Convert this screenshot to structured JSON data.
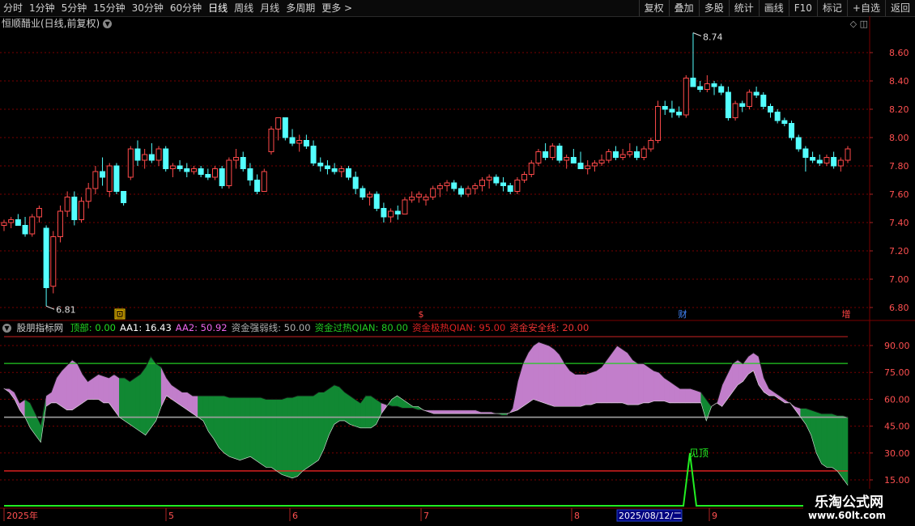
{
  "toolbar": {
    "left": [
      "分时",
      "1分钟",
      "5分钟",
      "15分钟",
      "30分钟",
      "60分钟",
      "日线",
      "周线",
      "月线",
      "多周期",
      "更多 >"
    ],
    "active": "日线",
    "right": [
      "复权",
      "叠加",
      "多股",
      "统计",
      "画线",
      "F10",
      "标记",
      "+自选",
      "返回"
    ]
  },
  "stock": {
    "title": "恒顺醋业(日线,前复权)"
  },
  "main_axis": [
    "8.60",
    "8.40",
    "8.20",
    "8.00",
    "7.80",
    "7.60",
    "7.40",
    "7.20",
    "7.00",
    "6.80"
  ],
  "annotations": {
    "high": "8.74",
    "low": "6.81"
  },
  "markers": [
    "回",
    "$",
    "财",
    "增"
  ],
  "indicator": {
    "name": "股朋指标网",
    "items": [
      {
        "label": "顶部: 0.00",
        "color": "#22dd22"
      },
      {
        "label": "AA1: 16.43",
        "color": "#ffffff"
      },
      {
        "label": "AA2: 50.92",
        "color": "#ee66ee"
      },
      {
        "label": "资金强弱线: 50.00",
        "color": "#b0b0b0"
      },
      {
        "label": "资金过热QIAN: 80.00",
        "color": "#22cc22"
      },
      {
        "label": "资金极热QIAN: 95.00",
        "color": "#dd2222"
      },
      {
        "label": "资金安全线: 20.00",
        "color": "#ee3333"
      }
    ],
    "axis": [
      "90.00",
      "75.00",
      "60.00",
      "45.00",
      "30.00",
      "15.00"
    ],
    "signal_label": "见顶"
  },
  "date_axis": {
    "labels": [
      "2025年",
      "5",
      "6",
      "7",
      "8",
      "9"
    ],
    "cursor": "2025/08/12/二"
  },
  "watermark": {
    "title": "乐淘公式网",
    "url": "www.60lt.com"
  },
  "chart_data": {
    "type": "candlestick",
    "title": "恒顺醋业(日线,前复权)",
    "y_ticks": [
      8.6,
      8.4,
      8.2,
      8.0,
      7.8,
      7.6,
      7.4,
      7.2,
      7.0,
      6.8
    ],
    "high": 8.74,
    "low": 6.81,
    "ohlc": [
      [
        7.38,
        7.42,
        7.34,
        7.4
      ],
      [
        7.4,
        7.44,
        7.36,
        7.42
      ],
      [
        7.42,
        7.46,
        7.38,
        7.38
      ],
      [
        7.38,
        7.44,
        7.3,
        7.32
      ],
      [
        7.32,
        7.46,
        7.3,
        7.44
      ],
      [
        7.44,
        7.52,
        7.4,
        7.5
      ],
      [
        7.36,
        7.38,
        6.81,
        6.94
      ],
      [
        6.95,
        7.34,
        6.9,
        7.3
      ],
      [
        7.3,
        7.52,
        7.26,
        7.48
      ],
      [
        7.48,
        7.62,
        7.44,
        7.58
      ],
      [
        7.58,
        7.62,
        7.38,
        7.42
      ],
      [
        7.42,
        7.58,
        7.4,
        7.55
      ],
      [
        7.55,
        7.68,
        7.5,
        7.64
      ],
      [
        7.64,
        7.8,
        7.6,
        7.76
      ],
      [
        7.76,
        7.86,
        7.66,
        7.72
      ],
      [
        7.62,
        7.82,
        7.58,
        7.8
      ],
      [
        7.8,
        7.82,
        7.6,
        7.62
      ],
      [
        7.62,
        7.6,
        7.52,
        7.54
      ],
      [
        7.72,
        7.94,
        7.7,
        7.92
      ],
      [
        7.92,
        7.98,
        7.8,
        7.84
      ],
      [
        7.84,
        7.92,
        7.78,
        7.88
      ],
      [
        7.88,
        7.96,
        7.82,
        7.84
      ],
      [
        7.84,
        7.94,
        7.8,
        7.92
      ],
      [
        7.92,
        7.94,
        7.76,
        7.78
      ],
      [
        7.78,
        7.82,
        7.72,
        7.8
      ],
      [
        7.8,
        7.84,
        7.76,
        7.78
      ],
      [
        7.78,
        7.82,
        7.72,
        7.76
      ],
      [
        7.76,
        7.8,
        7.74,
        7.78
      ],
      [
        7.78,
        7.8,
        7.72,
        7.74
      ],
      [
        7.74,
        7.78,
        7.7,
        7.72
      ],
      [
        7.72,
        7.8,
        7.7,
        7.78
      ],
      [
        7.78,
        7.8,
        7.64,
        7.66
      ],
      [
        7.66,
        7.86,
        7.64,
        7.84
      ],
      [
        7.84,
        7.92,
        7.78,
        7.86
      ],
      [
        7.86,
        7.9,
        7.76,
        7.78
      ],
      [
        7.78,
        7.82,
        7.66,
        7.7
      ],
      [
        7.7,
        7.74,
        7.6,
        7.62
      ],
      [
        7.62,
        7.78,
        7.62,
        7.76
      ],
      [
        7.9,
        8.08,
        7.88,
        8.06
      ],
      [
        8.06,
        8.12,
        7.98,
        8.14
      ],
      [
        8.14,
        8.14,
        7.98,
        8.0
      ],
      [
        8.0,
        8.06,
        7.94,
        7.96
      ],
      [
        7.96,
        8.02,
        7.9,
        7.98
      ],
      [
        7.98,
        8.02,
        7.92,
        7.94
      ],
      [
        7.94,
        7.98,
        7.8,
        7.82
      ],
      [
        7.82,
        7.86,
        7.76,
        7.8
      ],
      [
        7.8,
        7.84,
        7.74,
        7.78
      ],
      [
        7.78,
        7.82,
        7.74,
        7.76
      ],
      [
        7.76,
        7.8,
        7.72,
        7.78
      ],
      [
        7.78,
        7.8,
        7.7,
        7.72
      ],
      [
        7.72,
        7.76,
        7.6,
        7.64
      ],
      [
        7.64,
        7.66,
        7.56,
        7.58
      ],
      [
        7.58,
        7.62,
        7.52,
        7.6
      ],
      [
        7.6,
        7.62,
        7.48,
        7.5
      ],
      [
        7.5,
        7.54,
        7.4,
        7.44
      ],
      [
        7.44,
        7.5,
        7.4,
        7.48
      ],
      [
        7.48,
        7.52,
        7.42,
        7.46
      ],
      [
        7.46,
        7.58,
        7.46,
        7.56
      ],
      [
        7.56,
        7.62,
        7.54,
        7.58
      ],
      [
        7.58,
        7.62,
        7.54,
        7.6
      ],
      [
        7.56,
        7.6,
        7.52,
        7.58
      ],
      [
        7.58,
        7.66,
        7.56,
        7.64
      ],
      [
        7.64,
        7.68,
        7.58,
        7.66
      ],
      [
        7.66,
        7.7,
        7.62,
        7.68
      ],
      [
        7.68,
        7.7,
        7.62,
        7.64
      ],
      [
        7.64,
        7.66,
        7.58,
        7.6
      ],
      [
        7.6,
        7.66,
        7.58,
        7.64
      ],
      [
        7.64,
        7.68,
        7.6,
        7.66
      ],
      [
        7.66,
        7.72,
        7.62,
        7.7
      ],
      [
        7.7,
        7.74,
        7.64,
        7.72
      ],
      [
        7.72,
        7.74,
        7.66,
        7.68
      ],
      [
        7.68,
        7.72,
        7.62,
        7.66
      ],
      [
        7.66,
        7.68,
        7.6,
        7.62
      ],
      [
        7.62,
        7.72,
        7.6,
        7.7
      ],
      [
        7.7,
        7.76,
        7.68,
        7.74
      ],
      [
        7.74,
        7.84,
        7.72,
        7.82
      ],
      [
        7.82,
        7.92,
        7.8,
        7.9
      ],
      [
        7.9,
        7.96,
        7.84,
        7.86
      ],
      [
        7.86,
        7.96,
        7.84,
        7.94
      ],
      [
        7.94,
        7.96,
        7.82,
        7.84
      ],
      [
        7.84,
        7.88,
        7.78,
        7.86
      ],
      [
        7.86,
        7.92,
        7.84,
        7.82
      ],
      [
        7.82,
        7.9,
        7.78,
        7.78
      ],
      [
        7.78,
        7.84,
        7.74,
        7.8
      ],
      [
        7.8,
        7.84,
        7.76,
        7.82
      ],
      [
        7.82,
        7.88,
        7.8,
        7.84
      ],
      [
        7.84,
        7.92,
        7.82,
        7.9
      ],
      [
        7.9,
        7.94,
        7.84,
        7.86
      ],
      [
        7.86,
        7.92,
        7.84,
        7.88
      ],
      [
        7.88,
        7.96,
        7.86,
        7.9
      ],
      [
        7.9,
        7.94,
        7.84,
        7.86
      ],
      [
        7.86,
        7.94,
        7.84,
        7.92
      ],
      [
        7.92,
        8.0,
        7.9,
        7.98
      ],
      [
        7.98,
        8.26,
        7.96,
        8.22
      ],
      [
        8.22,
        8.26,
        8.16,
        8.2
      ],
      [
        8.2,
        8.26,
        8.14,
        8.18
      ],
      [
        8.18,
        8.22,
        8.14,
        8.16
      ],
      [
        8.16,
        8.44,
        8.14,
        8.42
      ],
      [
        8.42,
        8.74,
        8.36,
        8.36
      ],
      [
        8.36,
        8.4,
        8.32,
        8.34
      ],
      [
        8.34,
        8.44,
        8.32,
        8.38
      ],
      [
        8.38,
        8.4,
        8.3,
        8.36
      ],
      [
        8.36,
        8.38,
        8.3,
        8.32
      ],
      [
        8.32,
        8.36,
        8.12,
        8.14
      ],
      [
        8.14,
        8.26,
        8.12,
        8.24
      ],
      [
        8.24,
        8.26,
        8.18,
        8.22
      ],
      [
        8.22,
        8.34,
        8.2,
        8.32
      ],
      [
        8.32,
        8.36,
        8.28,
        8.3
      ],
      [
        8.3,
        8.32,
        8.2,
        8.22
      ],
      [
        8.22,
        8.24,
        8.14,
        8.18
      ],
      [
        8.18,
        8.2,
        8.1,
        8.12
      ],
      [
        8.12,
        8.14,
        8.08,
        8.1
      ],
      [
        8.1,
        8.12,
        7.98,
        8.0
      ],
      [
        8.0,
        8.02,
        7.9,
        7.92
      ],
      [
        7.92,
        7.94,
        7.76,
        7.86
      ],
      [
        7.86,
        7.9,
        7.82,
        7.84
      ],
      [
        7.84,
        7.88,
        7.8,
        7.82
      ],
      [
        7.82,
        7.88,
        7.8,
        7.86
      ],
      [
        7.86,
        7.9,
        7.78,
        7.8
      ],
      [
        7.8,
        7.86,
        7.76,
        7.84
      ],
      [
        7.84,
        7.94,
        7.82,
        7.92
      ]
    ],
    "indicator_series": {
      "y_ticks": [
        90,
        75,
        60,
        45,
        30,
        15
      ],
      "strength_line": 50,
      "overheat_line": 80,
      "safe_line": 20,
      "aa2": [
        66,
        66,
        64,
        58,
        60,
        58,
        52,
        46,
        62,
        64,
        72,
        76,
        79,
        82,
        80,
        74,
        70,
        72,
        74,
        73,
        72,
        74,
        72,
        72,
        70,
        72,
        74,
        78,
        84,
        80,
        78,
        72,
        68,
        66,
        64,
        64,
        62,
        62,
        62,
        62,
        62,
        62,
        62,
        61,
        61,
        61,
        61,
        61,
        61,
        61,
        60,
        60,
        60,
        60,
        61,
        61,
        62,
        62,
        62,
        62,
        64,
        64,
        66,
        68,
        67,
        64,
        62,
        60,
        58,
        62,
        62,
        60,
        58,
        57,
        56,
        56,
        55,
        55,
        55,
        54,
        54,
        54,
        54,
        54,
        54,
        54,
        54,
        54,
        54,
        54,
        54,
        53,
        53,
        53,
        52,
        51,
        51,
        55,
        70,
        80,
        86,
        90,
        92,
        91,
        90,
        88,
        85,
        80,
        76,
        74,
        74,
        74,
        75,
        76,
        78,
        82,
        86,
        90,
        88,
        86,
        82,
        80,
        80,
        78,
        76,
        75,
        72,
        70,
        68,
        66,
        66,
        66,
        65,
        64,
        60,
        56,
        58,
        68,
        74,
        80,
        82,
        80,
        84,
        86,
        84,
        72,
        66,
        64,
        62,
        60,
        58,
        56,
        55,
        55,
        54,
        53,
        52,
        52,
        52,
        51,
        51,
        50
      ],
      "aa1": [
        66,
        64,
        60,
        54,
        50,
        44,
        40,
        36,
        56,
        58,
        58,
        56,
        54,
        54,
        56,
        58,
        60,
        60,
        60,
        58,
        58,
        54,
        50,
        48,
        46,
        44,
        42,
        40,
        44,
        48,
        56,
        62,
        60,
        58,
        56,
        54,
        52,
        50,
        48,
        42,
        38,
        33,
        30,
        28,
        27,
        26,
        27,
        28,
        26,
        24,
        22,
        22,
        20,
        18,
        17,
        16,
        17,
        20,
        22,
        24,
        26,
        32,
        40,
        46,
        48,
        48,
        46,
        45,
        44,
        44,
        44,
        46,
        52,
        56,
        60,
        62,
        60,
        58,
        56,
        56,
        54,
        53,
        52,
        52,
        52,
        52,
        52,
        52,
        52,
        52,
        52,
        52,
        52,
        52,
        52,
        52,
        52,
        53,
        54,
        56,
        58,
        60,
        59,
        58,
        57,
        56,
        56,
        56,
        56,
        56,
        56,
        57,
        57,
        58,
        58,
        58,
        58,
        58,
        58,
        57,
        57,
        57,
        58,
        58,
        59,
        59,
        59,
        58,
        58,
        58,
        58,
        58,
        58,
        58,
        48,
        56,
        58,
        56,
        60,
        64,
        68,
        70,
        74,
        76,
        68,
        64,
        62,
        62,
        60,
        58,
        58,
        54,
        50,
        46,
        40,
        30,
        24,
        22,
        22,
        20,
        16,
        12
      ]
    },
    "signal": {
      "label": "见顶",
      "at_date": "2025/08/12/二"
    }
  }
}
